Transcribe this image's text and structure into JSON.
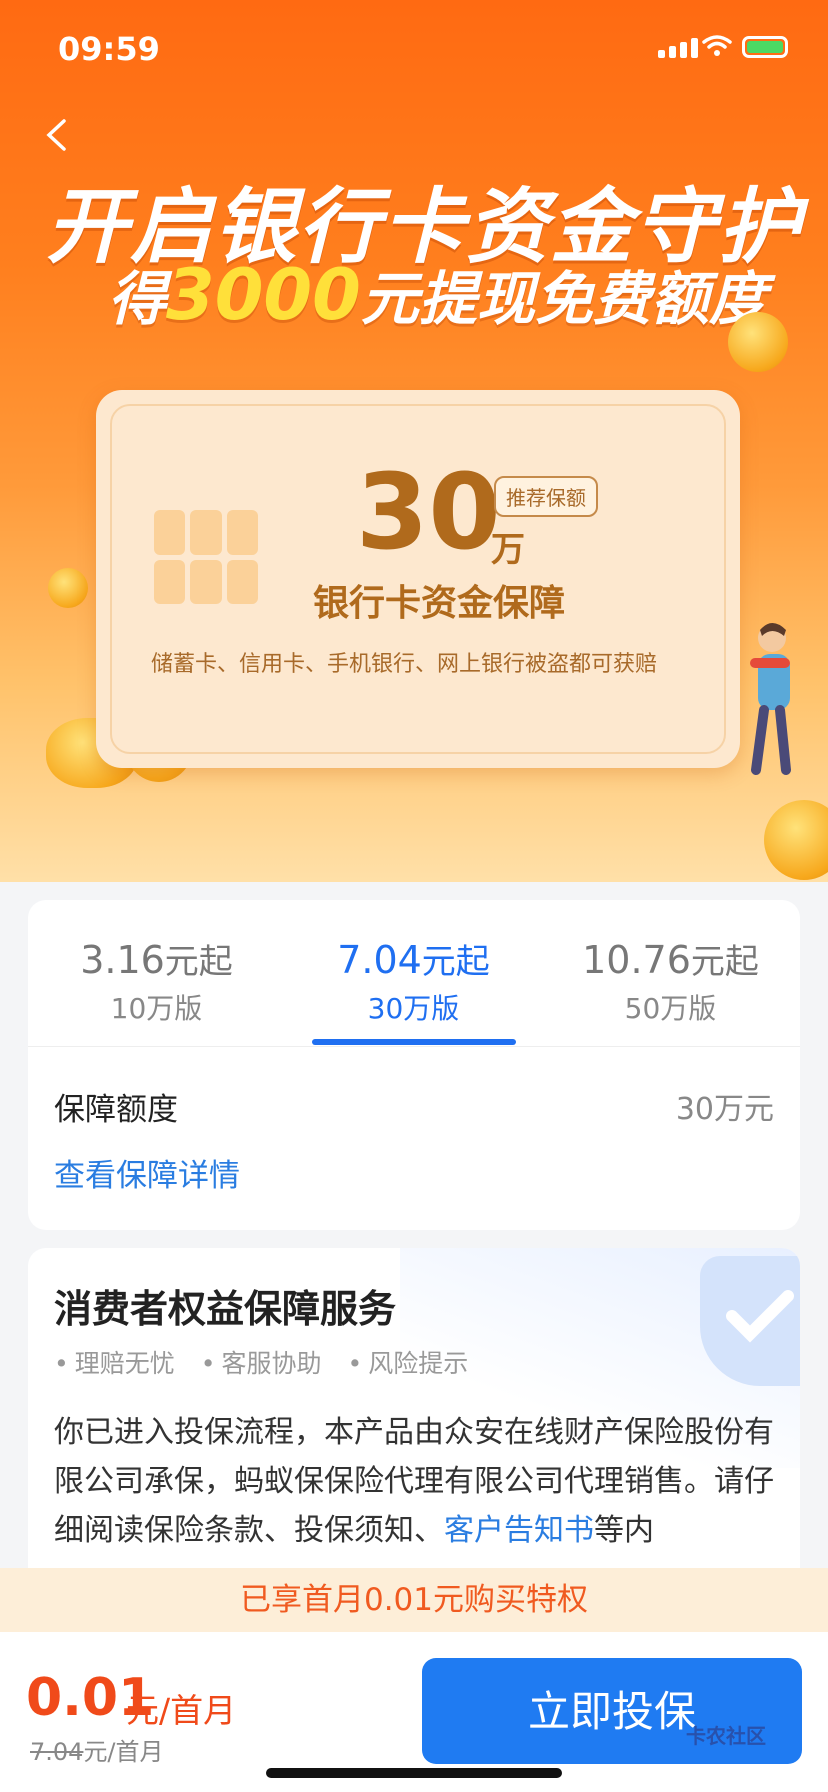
{
  "status_bar": {
    "time": "09:59"
  },
  "hero": {
    "headline": "开启银行卡资金守护",
    "subline_prefix": "得",
    "subline_amount": "3000",
    "subline_suffix": "元提现免费额度",
    "card": {
      "amount": "30",
      "amount_unit": "万",
      "tag": "推荐保额",
      "title": "银行卡资金保障",
      "subtitle": "储蓄卡、信用卡、手机银行、网上银行被盗都可获赔"
    }
  },
  "plans": {
    "tabs": [
      {
        "price": "3.16",
        "price_suffix": "元起",
        "version": "10万版"
      },
      {
        "price": "7.04",
        "price_suffix": "元起",
        "version": "30万版"
      },
      {
        "price": "10.76",
        "price_suffix": "元起",
        "version": "50万版"
      }
    ],
    "selected_index": 1
  },
  "coverage": {
    "label": "保障额度",
    "value": "30万元",
    "detail_link": "查看保障详情"
  },
  "consumer": {
    "title": "消费者权益保障服务",
    "bullets": [
      "理赔无忧",
      "客服协助",
      "风险提示"
    ],
    "para_1": "你已进入投保流程，本产品由众安在线财产保险股份有限公司承保，蚂蚁保保险代理有限公司代理销售。请仔细阅读保险条款、投保须知、",
    "para_link": "客户告知书",
    "para_2": "等内"
  },
  "promo_banner": "已享首月0.01元购买特权",
  "footer": {
    "price": "0.01",
    "price_unit": "元/首月",
    "original_price": "7.04",
    "original_unit": "元/首月",
    "buy_button": "立即投保",
    "watermark": "卡农社区"
  },
  "colors": {
    "accent": "#1f7bf2",
    "price": "#f04a1a",
    "hero": "#ff7f1e"
  }
}
